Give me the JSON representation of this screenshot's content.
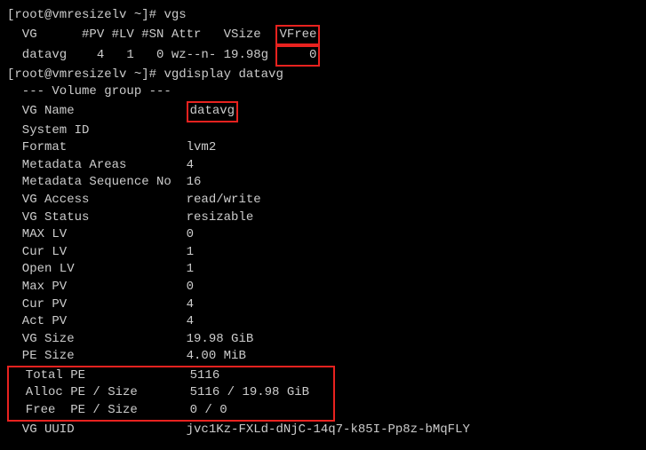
{
  "prompt1": "[root@vmresizelv ~]# ",
  "cmd1": "vgs",
  "vgs_header_before": "  VG      #PV #LV #SN Attr   VSize  ",
  "vgs_header_box": "VFree",
  "vgs_row_before": "  datavg    4   1   0 wz--n- 19.98g ",
  "vgs_row_box": "    0",
  "prompt2": "[root@vmresizelv ~]# ",
  "cmd2": "vgdisplay datavg",
  "section_header": "  --- Volume group ---",
  "vg_name_label": "  VG Name               ",
  "vg_name_value": "datavg",
  "rows": {
    "system_id": "  System ID",
    "format": "  Format                lvm2",
    "metadata_areas": "  Metadata Areas        4",
    "metadata_seq": "  Metadata Sequence No  16",
    "vg_access": "  VG Access             read/write",
    "vg_status": "  VG Status             resizable",
    "max_lv": "  MAX LV                0",
    "cur_lv": "  Cur LV                1",
    "open_lv": "  Open LV               1",
    "max_pv": "  Max PV                0",
    "cur_pv": "  Cur PV                4",
    "act_pv": "  Act PV                4",
    "vg_size": "  VG Size               19.98 GiB",
    "pe_size": "  PE Size               4.00 MiB"
  },
  "pe_block": {
    "total_pe": "  Total PE              5116",
    "alloc_pe": "  Alloc PE / Size       5116 / 19.98 GiB   ",
    "free_pe": "  Free  PE / Size       0 / 0"
  },
  "vg_uuid": "  VG UUID               jvc1Kz-FXLd-dNjC-14q7-k85I-Pp8z-bMqFLY"
}
